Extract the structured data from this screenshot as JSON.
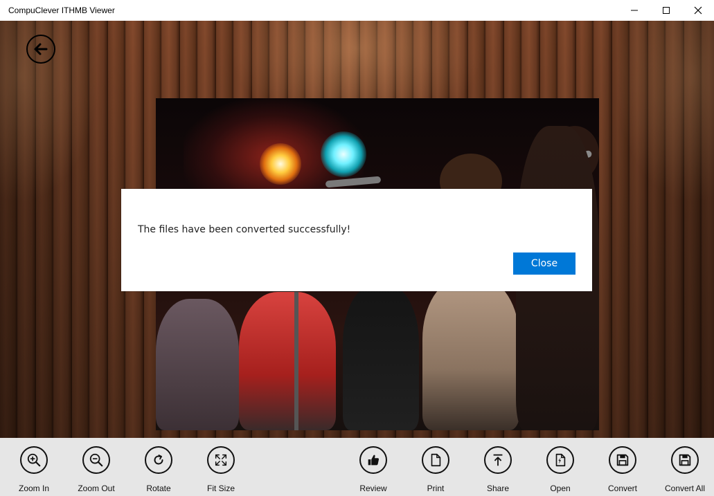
{
  "window": {
    "title": "CompuClever ITHMB Viewer",
    "controls": {
      "minimize": "minimize-icon",
      "maximize": "maximize-icon",
      "close": "close-icon"
    }
  },
  "navigation": {
    "back_icon": "back-arrow-icon"
  },
  "dialog": {
    "message": "The files have been converted successfully!",
    "close_label": "Close",
    "accent_color": "#0078d7"
  },
  "toolbar": {
    "left_items": [
      {
        "label": "Zoom In",
        "icon": "zoom-in-icon"
      },
      {
        "label": "Zoom Out",
        "icon": "zoom-out-icon"
      },
      {
        "label": "Rotate",
        "icon": "rotate-icon"
      },
      {
        "label": "Fit Size",
        "icon": "fit-size-icon"
      }
    ],
    "right_items": [
      {
        "label": "Review",
        "icon": "thumbs-up-icon"
      },
      {
        "label": "Print",
        "icon": "document-icon"
      },
      {
        "label": "Share",
        "icon": "upload-icon"
      },
      {
        "label": "Open",
        "icon": "open-file-icon"
      },
      {
        "label": "Convert",
        "icon": "save-icon"
      },
      {
        "label": "Convert All",
        "icon": "save-all-icon"
      }
    ]
  }
}
